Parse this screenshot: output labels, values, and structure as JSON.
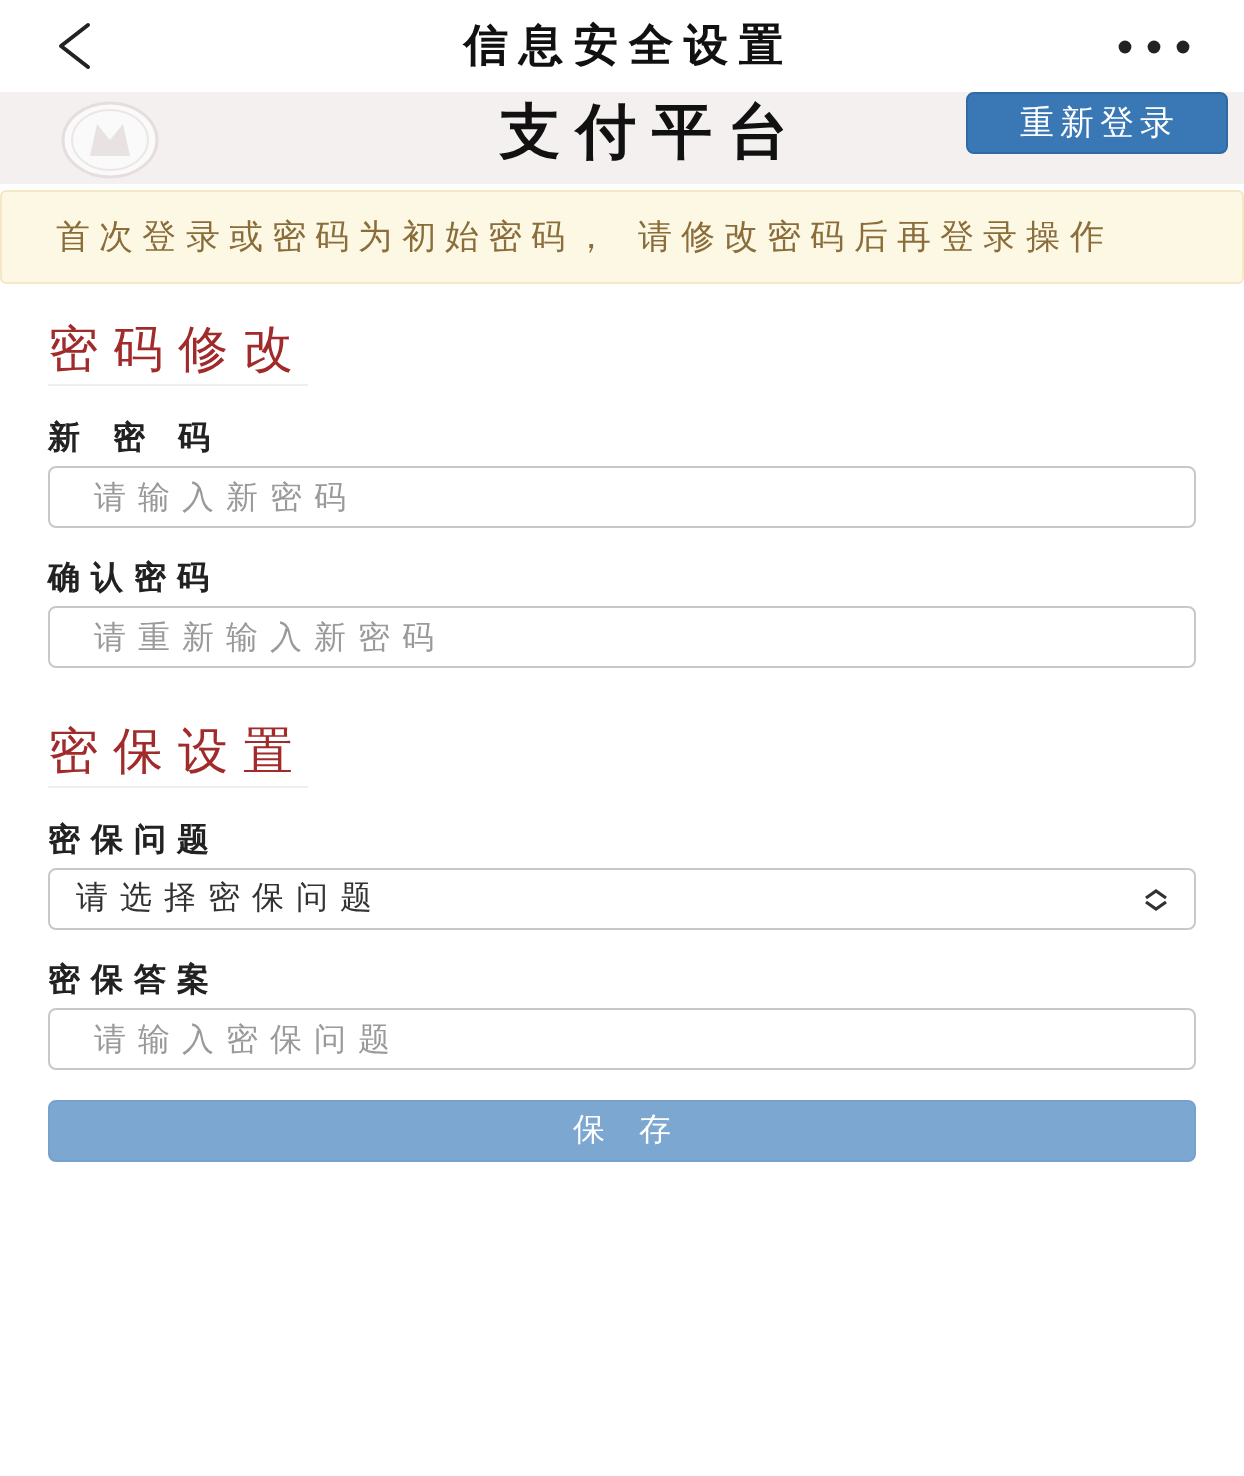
{
  "nav": {
    "title": "信息安全设置"
  },
  "header": {
    "title": "支付平台",
    "relogin_button": "重新登录"
  },
  "notice": "首次登录或密码为初始密码， 请修改密码后再登录操作",
  "sections": [
    {
      "title": "密码修改",
      "fields": [
        {
          "kind": "input",
          "label": "新 密 码",
          "placeholder": "请输入新密码"
        },
        {
          "kind": "input",
          "label": "确认密码",
          "placeholder": "请重新输入新密码"
        }
      ]
    },
    {
      "title": "密保设置",
      "fields": [
        {
          "kind": "select",
          "label": "密保问题",
          "value": "请选择密保问题"
        },
        {
          "kind": "input",
          "label": "密保答案",
          "placeholder": "请输入密保问题"
        }
      ]
    }
  ],
  "save_button": "保 存"
}
